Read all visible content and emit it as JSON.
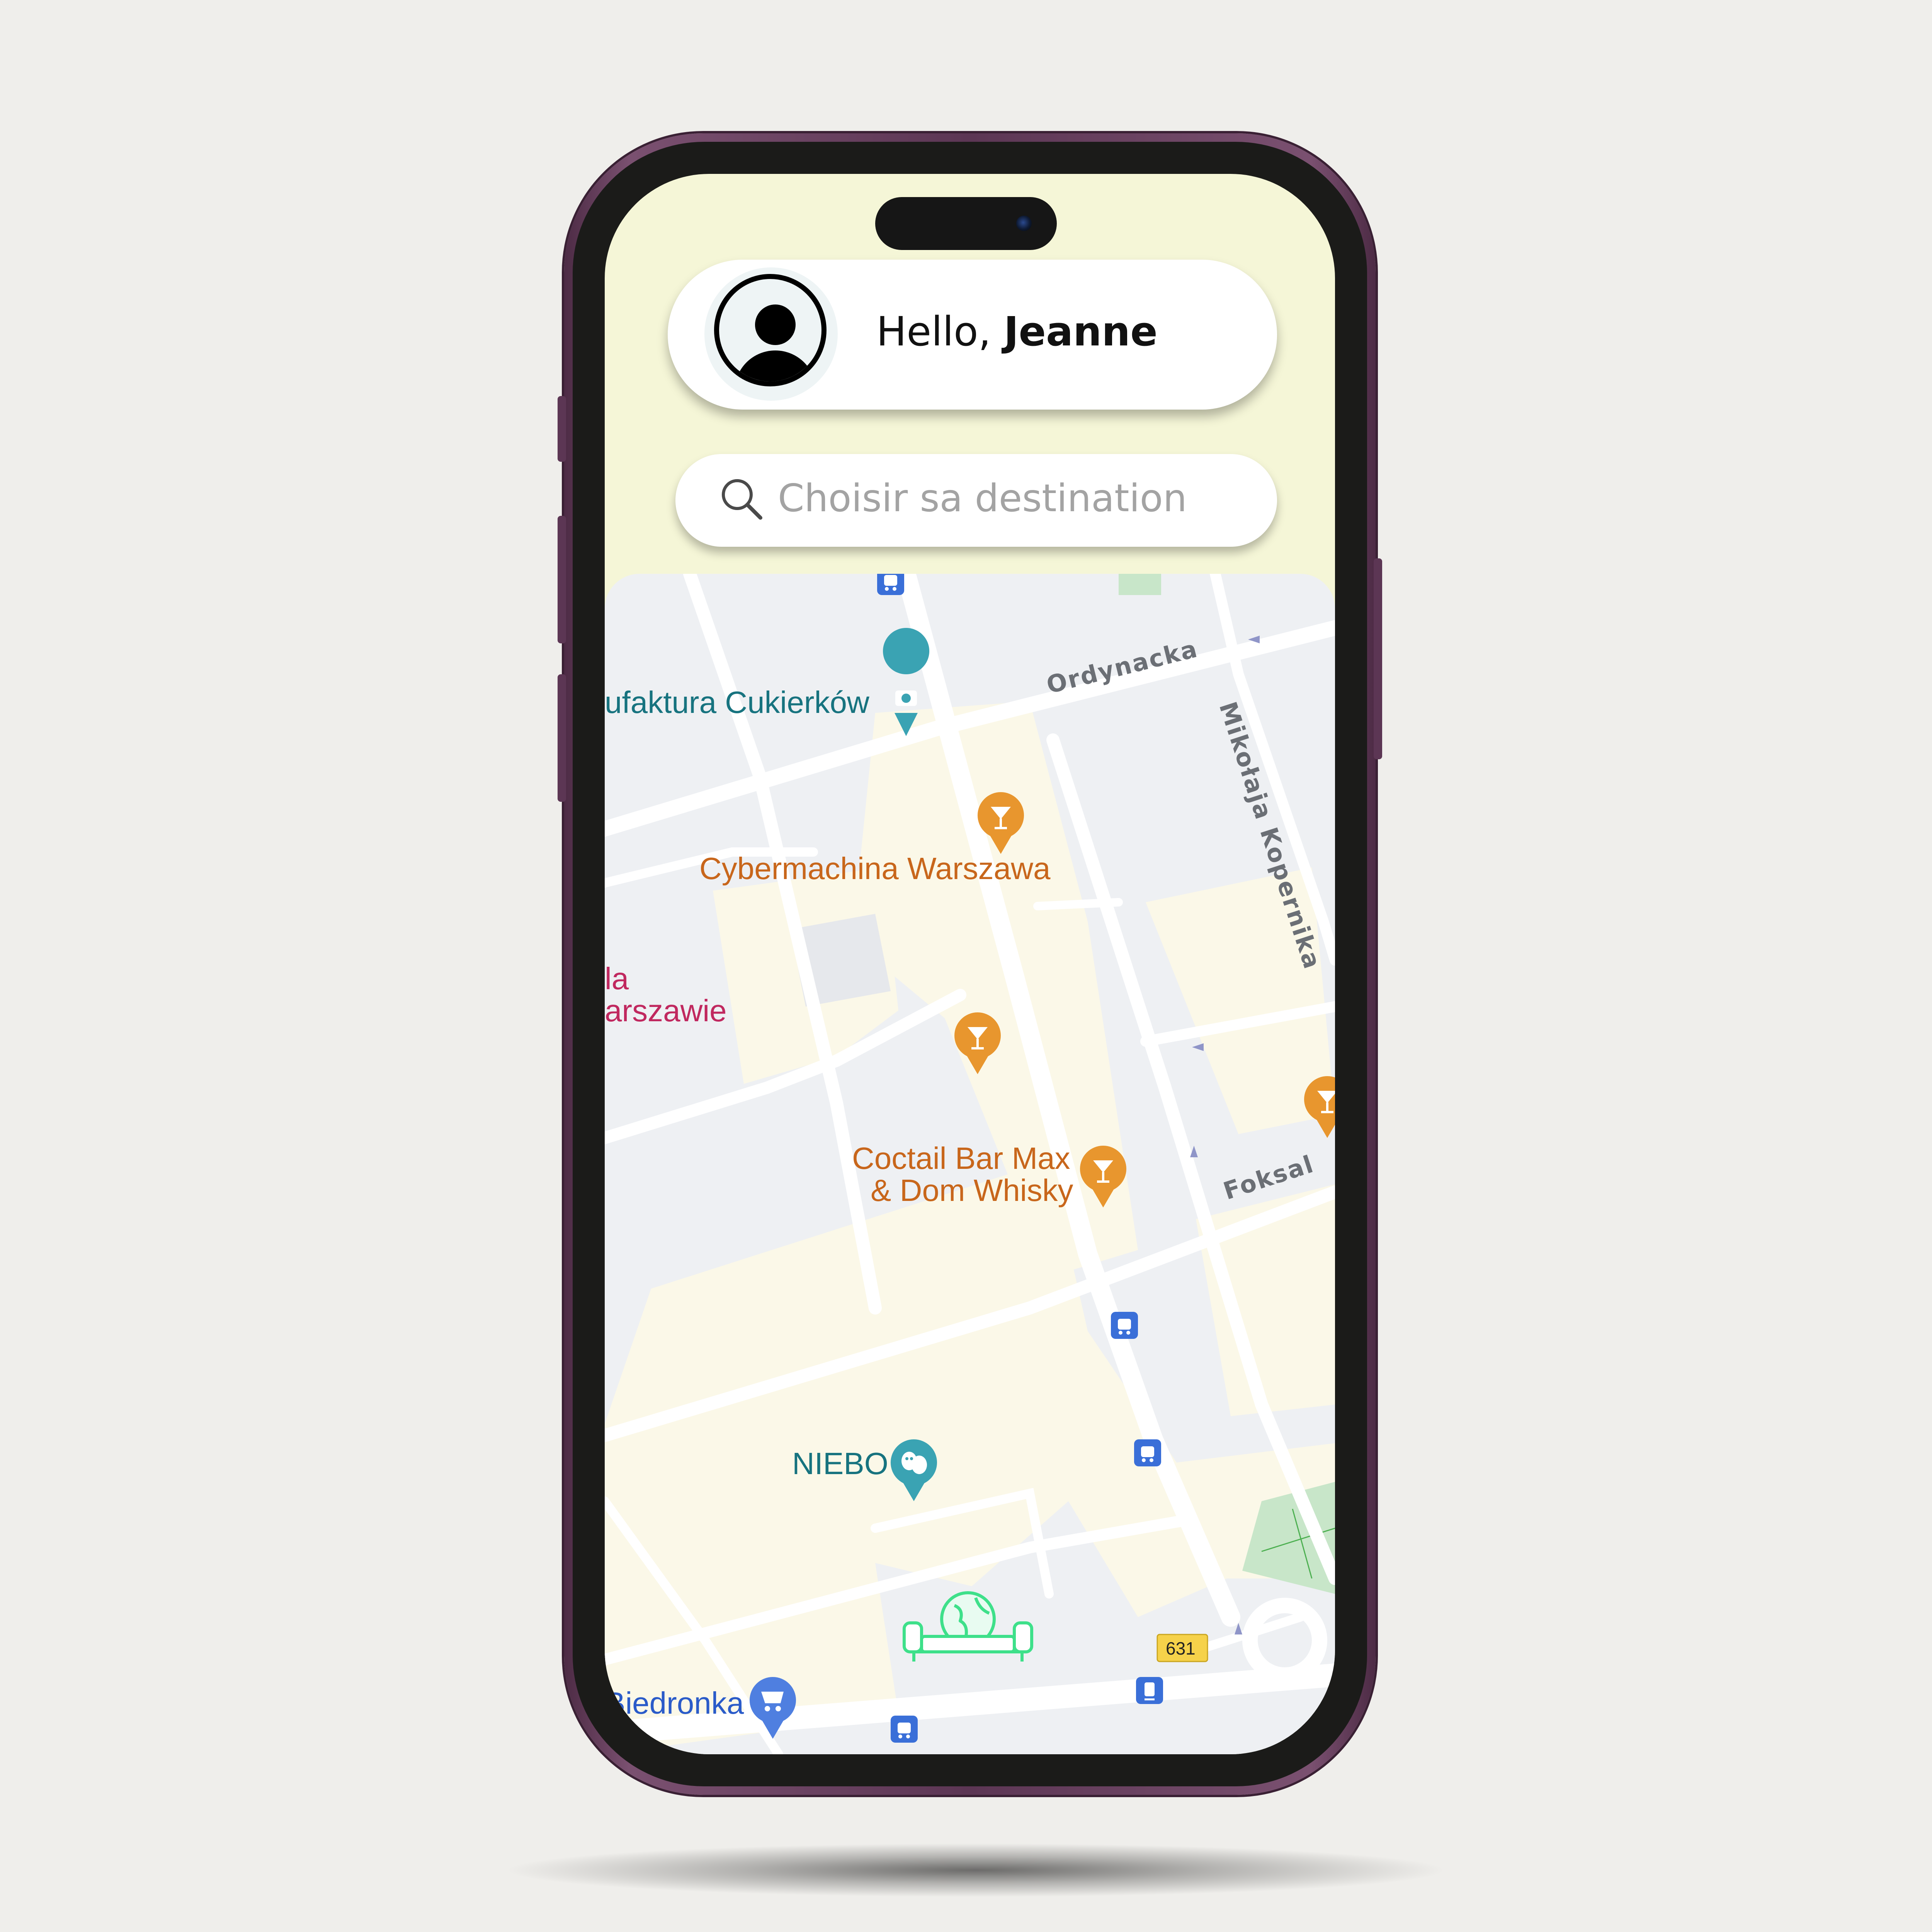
{
  "header": {
    "greeting_prefix": "Hello, ",
    "user_name": "Jeanne"
  },
  "search": {
    "placeholder": "Choisir sa destination"
  },
  "map": {
    "streets": [
      "Ordynacka",
      "Mikołaja Kopernika",
      "Foksal"
    ],
    "places": [
      {
        "name": "ufaktura Cukierków",
        "category": "camera-icon"
      },
      {
        "name": "Cybermachina Warszawa",
        "category": "cocktail-icon"
      },
      {
        "name": "la",
        "category": "text"
      },
      {
        "name": "arszawie",
        "category": "text"
      },
      {
        "name_line1": "Coctail Bar Max",
        "name_line2": "& Dom Whisky",
        "category": "cocktail-icon"
      },
      {
        "name": "NIEBO",
        "category": "theater-icon"
      },
      {
        "name": "Biedronka",
        "category": "cart-icon"
      }
    ],
    "route_badge": "631",
    "colors": {
      "block_beige": "#fbf8e8",
      "road": "#ffffff",
      "block_gray": "#eef0f3",
      "park": "#c8e6c9",
      "poi_orange": "#e8962e",
      "poi_teal": "#3aa3b3",
      "poi_blue": "#4f7fe0",
      "transit": "#3a6fd8",
      "user_marker": "#3ee08a"
    }
  },
  "theme": {
    "screen_top_bg": "#f5f6d7",
    "frame": "#5c3654"
  }
}
